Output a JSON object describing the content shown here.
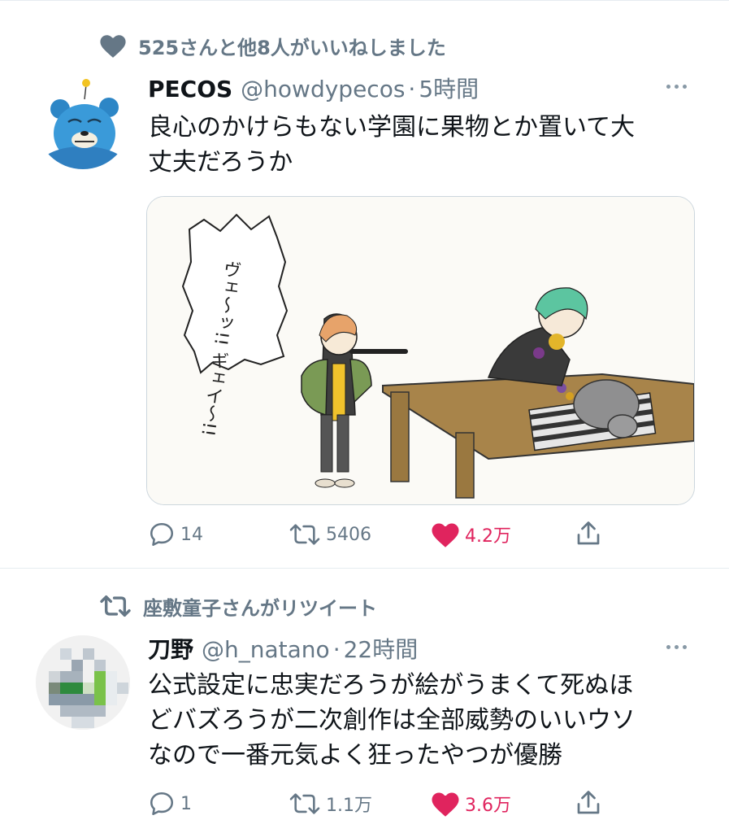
{
  "tweets": [
    {
      "social_context": "525さんと他8人がいいねしました",
      "social_icon": "heart-icon",
      "name": "PECOS",
      "handle": "@howdypecos",
      "sep": "·",
      "time": "5時間",
      "text": "良心のかけらもない学園に果物とか置いて大\n丈夫だろうか",
      "has_media": true,
      "media_sfx": "ヴェ〜ッ!! ギェイ〜!!",
      "counts": {
        "reply": "14",
        "retweet": "5406",
        "like": "4.2万"
      },
      "liked": true
    },
    {
      "social_context": "座敷童子さんがリツイート",
      "social_icon": "retweet-icon",
      "name": "刀野",
      "handle": "@h_natano",
      "sep": "·",
      "time": "22時間",
      "text": "公式設定に忠実だろうが絵がうまくて死ぬほ\nどバズろうが二次創作は全部威勢のいいウソ\nなので一番元気よく狂ったやつが優勝",
      "has_media": false,
      "counts": {
        "reply": "1",
        "retweet": "1.1万",
        "like": "3.6万"
      },
      "liked": true
    }
  ],
  "colors": {
    "text": "#0f1419",
    "secondary": "#657786",
    "like": "#e0245e",
    "divider": "#e6ecf0"
  }
}
